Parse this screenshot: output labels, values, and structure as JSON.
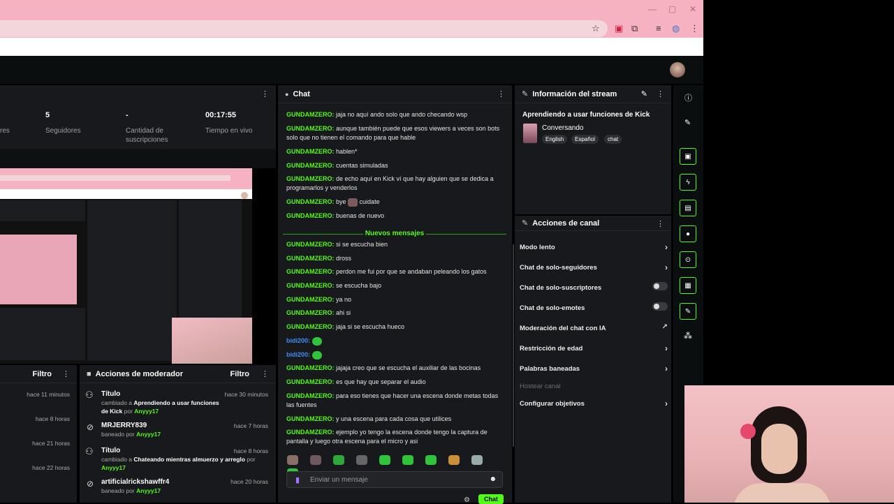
{
  "browser": {
    "window_controls": [
      "—",
      "▢",
      "✕"
    ],
    "toolbar_icons": [
      "☆",
      "▣",
      "⧉",
      "≡",
      "◍",
      "⋮"
    ]
  },
  "stats": {
    "partial_label": "res",
    "followers_value": "5",
    "followers_label": "Seguidores",
    "subs_value": "-",
    "subs_label": "Cantidad de suscripciones",
    "live_value": "00:17:55",
    "live_label": "Tiempo en vivo"
  },
  "chat": {
    "title": "Chat",
    "divider": "Nuevos mensajes",
    "messages": [
      {
        "user": "GUNDAMZERO",
        "text": "jaja no aquí ando solo que ando checando wsp"
      },
      {
        "user": "GUNDAMZERO",
        "text": "aunque también puede que esos viewers a veces son bots solo que no tienen el comando para que hable"
      },
      {
        "user": "GUNDAMZERO",
        "text": "hablen*"
      },
      {
        "user": "GUNDAMZERO",
        "text": "cuentas simuladas"
      },
      {
        "user": "GUNDAMZERO",
        "text": "de echo aquí en Kick ví que hay alguien que se dedica a programarlos y venderlos"
      },
      {
        "user": "GUNDAMZERO",
        "text": "bye",
        "text2": "cuidate"
      },
      {
        "user": "GUNDAMZERO",
        "text": "buenas de nuevo"
      },
      {
        "user": "GUNDAMZERO",
        "text": "si se escucha bien"
      },
      {
        "user": "GUNDAMZERO",
        "text": "dross"
      },
      {
        "user": "GUNDAMZERO",
        "text": "perdon me fui por que se andaban peleando los gatos"
      },
      {
        "user": "GUNDAMZERO",
        "text": "se escucha bajo"
      },
      {
        "user": "GUNDAMZERO",
        "text": "ya no"
      },
      {
        "user": "GUNDAMZERO",
        "text": "ahi si"
      },
      {
        "user": "GUNDAMZERO",
        "text": "jaja si se escucha hueco"
      },
      {
        "user": "bidi200",
        "text": ""
      },
      {
        "user": "bidi200",
        "text": ""
      },
      {
        "user": "GUNDAMZERO",
        "text": "jajaja creo que se escucha el auxiliar de las bocinas"
      },
      {
        "user": "GUNDAMZERO",
        "text": "es que hay que separar el audio"
      },
      {
        "user": "GUNDAMZERO",
        "text": "para eso tienes que hacer una escena donde metas todas las fuentes"
      },
      {
        "user": "GUNDAMZERO",
        "text": "y una escena para cada cosa que utilices"
      },
      {
        "user": "GUNDAMZERO",
        "text": "ejemplo yo tengo la escena donde tengo la captura de pantalla y luego otra escena para el micro y asi"
      }
    ],
    "input_placeholder": "Enviar un mensaje",
    "send_label": "Chat"
  },
  "stream_info": {
    "title": "Información del stream",
    "stream_title": "Aprendiendo a usar funciones de Kick",
    "category": "Conversando",
    "tags": [
      "English",
      "Español",
      "chat"
    ]
  },
  "channel_actions": {
    "title": "Acciones de canal",
    "items": [
      {
        "label": "Modo lento",
        "control": "chevron"
      },
      {
        "label": "Chat de solo-seguidores",
        "control": "chevron"
      },
      {
        "label": "Chat de solo-suscriptores",
        "control": "toggle"
      },
      {
        "label": "Chat de solo-emotes",
        "control": "toggle"
      },
      {
        "label": "Moderación del chat con IA",
        "control": "external"
      },
      {
        "label": "Restricción de edad",
        "control": "chevron"
      },
      {
        "label": "Palabras baneadas",
        "control": "chevron"
      },
      {
        "label": "Hostear canal",
        "control": "none"
      },
      {
        "label": "Configurar objetivos",
        "control": "chevron"
      }
    ]
  },
  "left_log": {
    "filter_label": "Filtro",
    "times": [
      "hace 11 minutos",
      "hace 8 horas",
      "hace 21 horas",
      "hace 22 horas"
    ]
  },
  "mod_actions": {
    "title": "Acciones de moderador",
    "filter_label": "Filtro",
    "items": [
      {
        "title": "Título",
        "prefix": "cambiado a",
        "target": "Aprendiendo a usar funciones de Kick",
        "by": "por",
        "actor": "Anyyy17",
        "time": "hace 30 minutos"
      },
      {
        "title": "MRJERRY839",
        "prefix": "baneado por",
        "target": "",
        "by": "",
        "actor": "Anyyy17",
        "time": "hace 7 horas"
      },
      {
        "title": "Título",
        "prefix": "cambiado a",
        "target": "Chateando mientras almuerzo y arreglo",
        "by": "por",
        "actor": "Anyyy17",
        "time": "hace 8 horas"
      },
      {
        "title": "artificialrickshawffr4",
        "prefix": "baneado por",
        "target": "",
        "by": "",
        "actor": "Anyyy17",
        "time": "hace 20 horas"
      }
    ]
  },
  "colors": {
    "accent": "#53fc18",
    "panel": "#18191c",
    "browser": "#f7b2c2"
  }
}
